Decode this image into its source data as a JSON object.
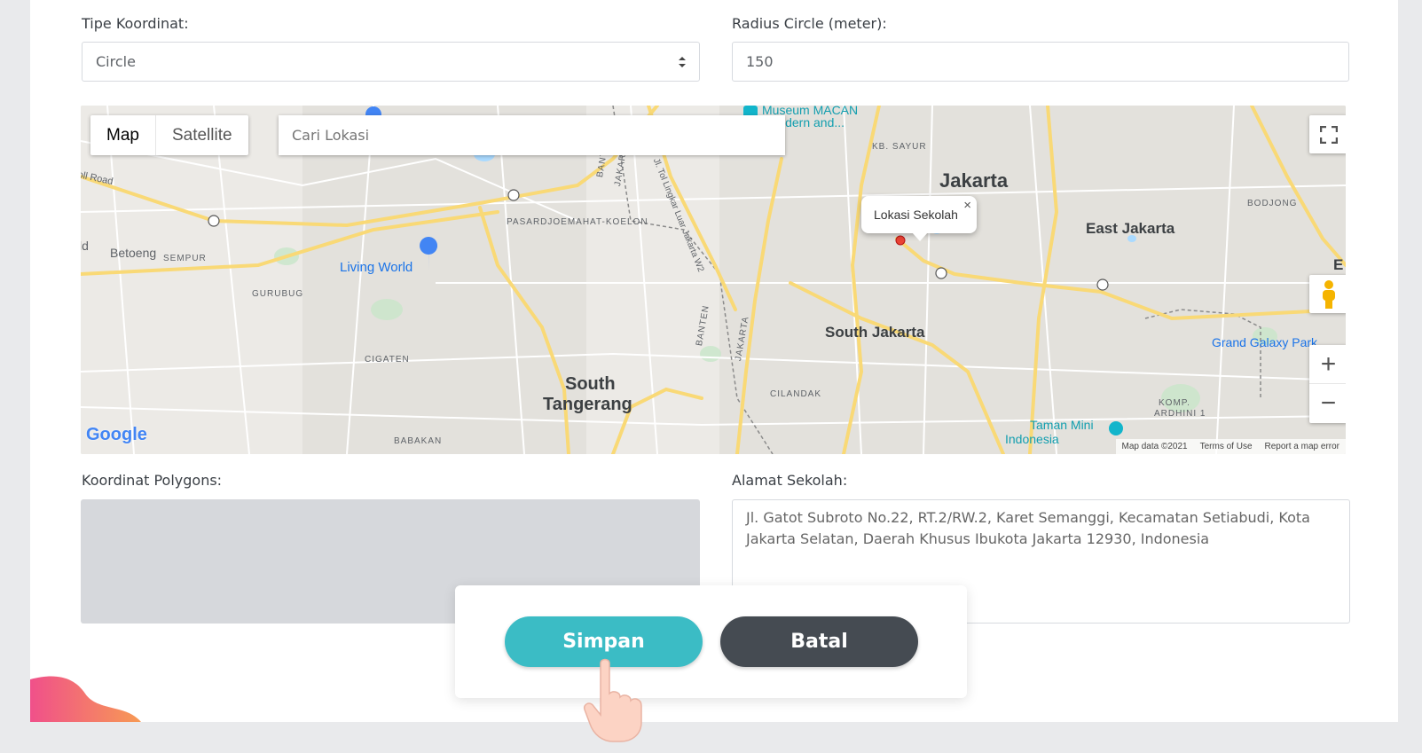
{
  "form": {
    "tipe_label": "Tipe Koordinat:",
    "tipe_value": "Circle",
    "radius_label": "Radius Circle (meter):",
    "radius_value": "150",
    "polygons_label": "Koordinat Polygons:",
    "alamat_label": "Alamat Sekolah:",
    "alamat_value": "Jl. Gatot Subroto No.22, RT.2/RW.2, Karet Semanggi, Kecamatan Setiabudi, Kota Jakarta Selatan, Daerah Khusus Ibukota Jakarta 12930, Indonesia"
  },
  "map": {
    "type_map": "Map",
    "type_satellite": "Satellite",
    "search_placeholder": "Cari Lokasi",
    "popup_text": "Lokasi Sekolah",
    "popup_close": "×",
    "zoom_in": "+",
    "zoom_out": "−",
    "google_logo": "Google",
    "attribution": [
      "Map data ©2021",
      "Terms of Use",
      "Report a map error"
    ],
    "labels": {
      "jakarta": "Jakarta",
      "east_jakarta": "East Jakarta",
      "south_jakarta": "South Jakarta",
      "south_tangerang_1": "South",
      "south_tangerang_2": "Tangerang",
      "living_world": "Living World",
      "museum_1": "Museum MACAN",
      "museum_2": "(Modern and...",
      "taman_mini_1": "Taman Mini",
      "taman_mini_2": "Indonesia",
      "grand_galaxy": "Grand Galaxy Park",
      "betoeng": "Betoeng",
      "kb_sayur": "KB. SAYUR",
      "bodjong": "BODJONG",
      "pasar": "PASARDJOEMAHAT-KOELON",
      "sempur": "SEMPUR",
      "gurubug": "GURUBUG",
      "cigaten": "CIGATEN",
      "cilandak": "CILANDAK",
      "babakan": "BABAKAN",
      "komp_1": "KOMP.",
      "komp_2": "ARDHINI 1",
      "banten_1": "BANTEN",
      "jakarta_v1": "JAKARTA",
      "banten_2": "BANTEN",
      "jakarta_v2": "JAKARTA",
      "toll_road": "oll Road",
      "ld": "ld",
      "e": "E",
      "jl_tol": "Jl. Tol Lingkar Luar Jakarta W2"
    }
  },
  "dialog": {
    "save_label": "Simpan",
    "cancel_label": "Batal"
  },
  "colors": {
    "save": "#3bbcc5",
    "cancel": "#454b52",
    "road": "#f9d976",
    "map_bg": "#eceae6"
  }
}
